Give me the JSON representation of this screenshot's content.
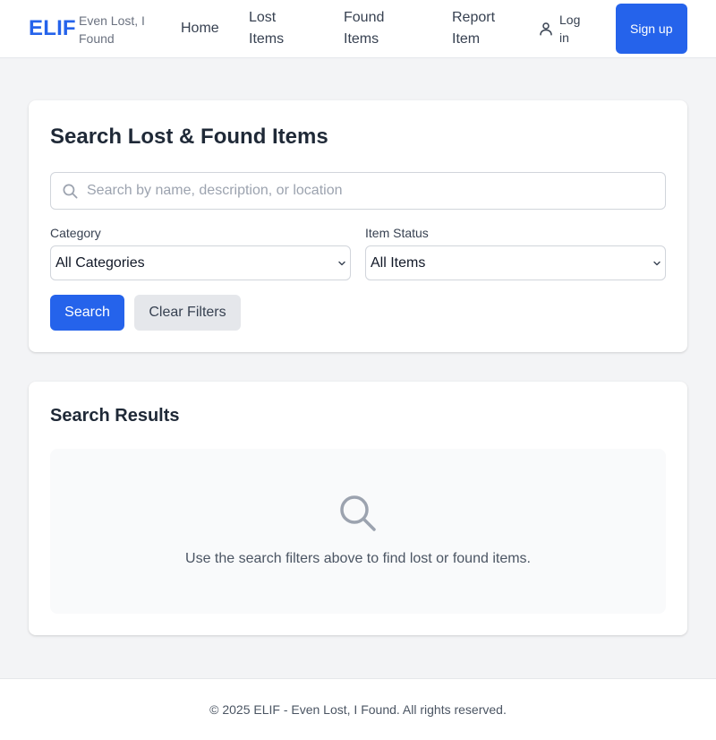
{
  "header": {
    "logo": "ELIF",
    "tagline": "Even Lost, I Found",
    "nav": {
      "home": "Home",
      "lost_items": "Lost Items",
      "found_items": "Found Items",
      "report_item": "Report Item"
    },
    "login_label": "Log in",
    "login_icon": "user-icon",
    "signup_label": "Sign up"
  },
  "search": {
    "title": "Search Lost & Found Items",
    "placeholder": "Search by name, description, or location",
    "value": "",
    "icon": "search-icon",
    "category_label": "Category",
    "category_value": "All Categories",
    "status_label": "Item Status",
    "status_value": "All Items",
    "search_button": "Search",
    "clear_button": "Clear Filters"
  },
  "results": {
    "title": "Search Results",
    "empty_icon": "search-icon",
    "empty_message": "Use the search filters above to find lost or found items."
  },
  "footer": {
    "text": "© 2025 ELIF - Even Lost, I Found. All rights reserved."
  },
  "colors": {
    "brand": "#2563eb",
    "background": "#f3f4f6",
    "card": "#ffffff",
    "text": "#1f2937",
    "muted": "#6b7280"
  }
}
